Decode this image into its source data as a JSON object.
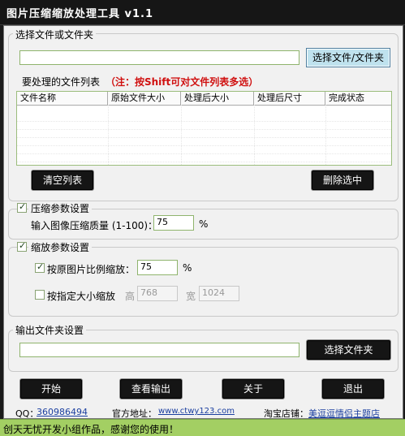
{
  "window": {
    "title": "图片压缩缩放处理工具  v1.1"
  },
  "file_group": {
    "legend": "选择文件或文件夹",
    "path_value": "",
    "select_button": "选择文件/文件夹",
    "list_label": "要处理的文件列表",
    "list_hint": "（注：按Shift可对文件列表多选）",
    "columns": [
      "文件名称",
      "原始文件大小",
      "处理后大小",
      "处理后尺寸",
      "完成状态"
    ],
    "clear_button": "清空列表",
    "delete_button": "删除选中"
  },
  "compress": {
    "legend": "压缩参数设置",
    "enabled": true,
    "quality_label": "输入图像压缩质量 (1-100)：",
    "quality_value": "75",
    "unit": "%"
  },
  "scale": {
    "legend": "缩放参数设置",
    "enabled": true,
    "ratio_label": "按原图片比例缩放：",
    "ratio_checked": true,
    "ratio_value": "75",
    "unit": "%",
    "size_label": "按指定大小缩放",
    "size_checked": false,
    "height_label": "高",
    "height_value": "768",
    "width_label": "宽",
    "width_value": "1024"
  },
  "output": {
    "legend": "输出文件夹设置",
    "path_value": "",
    "select_button": "选择文件夹"
  },
  "actions": {
    "start": "开始",
    "view": "查看输出",
    "about": "关于",
    "exit": "退出"
  },
  "footer": {
    "qq_label": "QQ：",
    "qq_value": "360986494",
    "site_label": "官方地址：",
    "site_value": "www.ctwy123.com",
    "shop_label": "淘宝店铺：",
    "shop_value": "美逗逗情侣主题店"
  },
  "status": {
    "text": "创天无忧开发小组作品，感谢您的使用！"
  }
}
